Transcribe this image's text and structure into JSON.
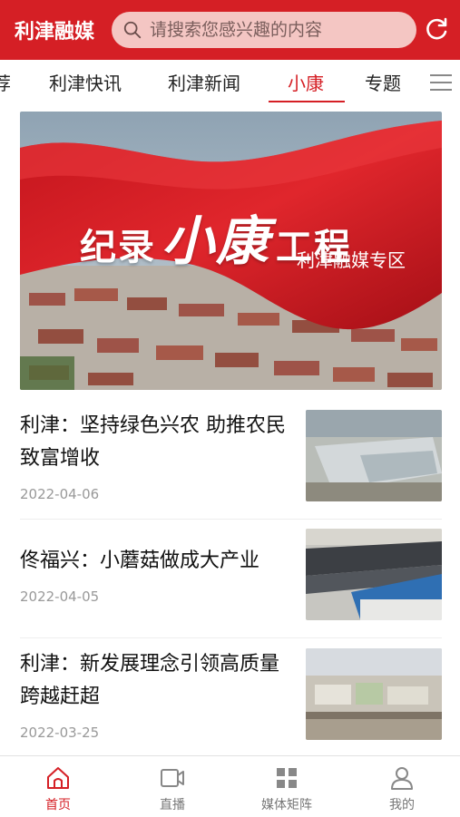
{
  "header": {
    "app_title": "利津融媒",
    "search_placeholder": "请搜索您感兴趣的内容"
  },
  "tabs": [
    {
      "label": "荐"
    },
    {
      "label": "利津快讯"
    },
    {
      "label": "利津新闻"
    },
    {
      "label": "小康",
      "active": true
    },
    {
      "label": "专题"
    }
  ],
  "banner": {
    "title_pre": "纪录",
    "title_big": "小康",
    "title_post": "工程",
    "subtitle": "利津融媒专区"
  },
  "news": [
    {
      "title": "利津：坚持绿色兴农 助推农民致富增收",
      "date": "2022-04-06"
    },
    {
      "title": "佟福兴：小蘑菇做成大产业",
      "date": "2022-04-05"
    },
    {
      "title": "利津：新发展理念引领高质量跨越赶超",
      "date": "2022-03-25"
    }
  ],
  "bottom_nav": [
    {
      "label": "首页",
      "icon": "home-icon",
      "active": true
    },
    {
      "label": "直播",
      "icon": "video-icon"
    },
    {
      "label": "媒体矩阵",
      "icon": "grid-icon"
    },
    {
      "label": "我的",
      "icon": "user-icon"
    }
  ],
  "colors": {
    "brand": "#d51f25",
    "search_bg": "#f4c6c3",
    "muted": "#999999"
  }
}
